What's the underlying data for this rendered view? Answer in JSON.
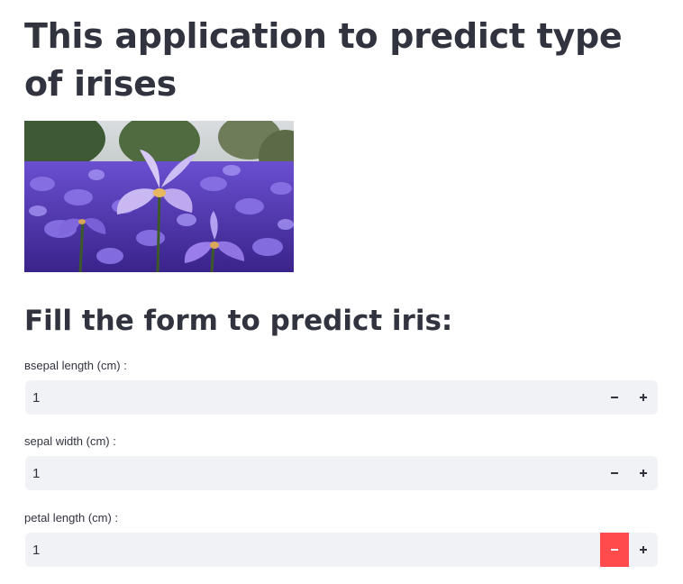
{
  "page": {
    "title": "This application to predict type of irises",
    "image_alt": "irises",
    "form_heading": "Fill the form to predict iris:"
  },
  "form": {
    "fields": [
      {
        "label": "вsepal length (cm) :",
        "value": "1"
      },
      {
        "label": "sepal width (cm) :",
        "value": "1"
      },
      {
        "label": "petal length (cm) :",
        "value": "1"
      }
    ]
  },
  "colors": {
    "text": "#31333f",
    "input_bg": "#f0f2f6",
    "active_step": "#ff4b4b"
  },
  "icons": {
    "decrement": "minus-icon",
    "increment": "plus-icon"
  }
}
